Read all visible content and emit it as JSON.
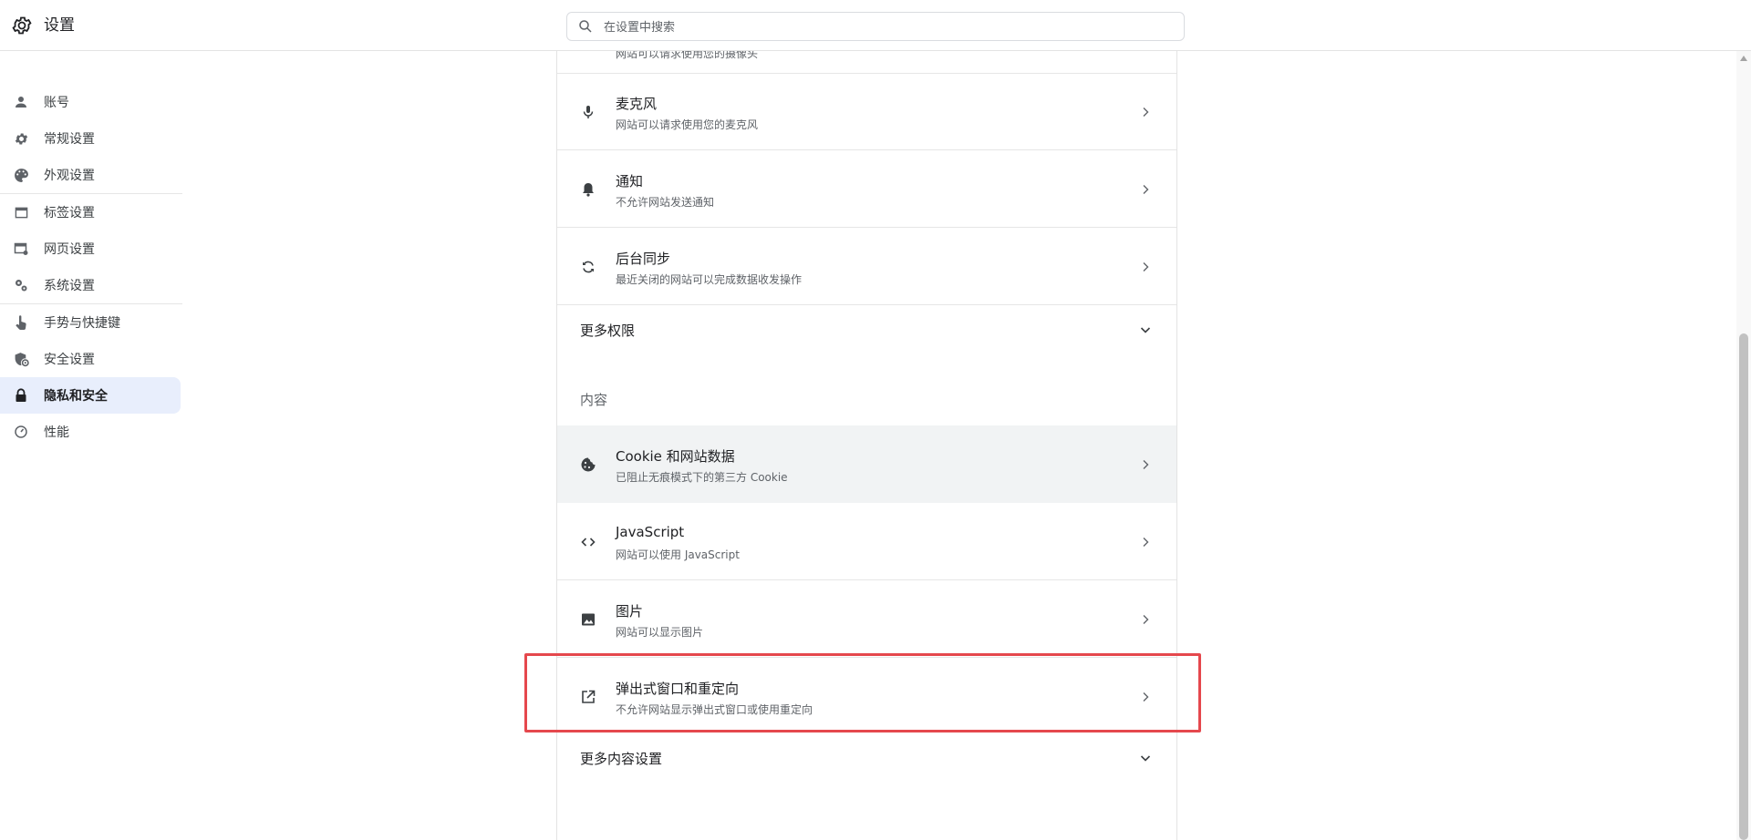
{
  "header": {
    "app_icon": "gear-icon",
    "title": "设置",
    "search_placeholder": "在设置中搜索"
  },
  "sidebar": {
    "items": [
      {
        "label": "账号",
        "icon": "person-icon"
      },
      {
        "label": "常规设置",
        "icon": "gear-icon"
      },
      {
        "label": "外观设置",
        "icon": "palette-icon"
      },
      {
        "label": "标签设置",
        "icon": "tab-window-icon"
      },
      {
        "label": "网页设置",
        "icon": "webpage-settings-icon"
      },
      {
        "label": "系统设置",
        "icon": "system-gears-icon"
      },
      {
        "label": "手势与快捷键",
        "icon": "hand-pointer-icon"
      },
      {
        "label": "安全设置",
        "icon": "shield-icon"
      },
      {
        "label": "隐私和安全",
        "icon": "lock-icon",
        "active": true
      },
      {
        "label": "性能",
        "icon": "speedometer-icon"
      }
    ]
  },
  "main": {
    "clipped_row_subtitle": "网站可以请求使用您的摄像头",
    "permissions": [
      {
        "title": "麦克风",
        "subtitle": "网站可以请求使用您的麦克风",
        "icon": "microphone-icon"
      },
      {
        "title": "通知",
        "subtitle": "不允许网站发送通知",
        "icon": "bell-icon"
      },
      {
        "title": "后台同步",
        "subtitle": "最近关闭的网站可以完成数据收发操作",
        "icon": "sync-icon"
      }
    ],
    "more_permissions": "更多权限",
    "content_label": "内容",
    "content": [
      {
        "title": "Cookie 和网站数据",
        "subtitle": "已阻止无痕模式下的第三方 Cookie",
        "icon": "cookie-icon",
        "highlighted": true
      },
      {
        "title": "JavaScript",
        "subtitle": "网站可以使用 JavaScript",
        "icon": "code-icon"
      },
      {
        "title": "图片",
        "subtitle": "网站可以显示图片",
        "icon": "image-icon"
      },
      {
        "title": "弹出式窗口和重定向",
        "subtitle": "不允许网站显示弹出式窗口或使用重定向",
        "icon": "open-in-new-icon"
      }
    ],
    "more_content": "更多内容设置"
  },
  "colors": {
    "accent": "#e8eefc",
    "highlight_box": "#e5484d",
    "row_hover": "#f1f3f4"
  }
}
